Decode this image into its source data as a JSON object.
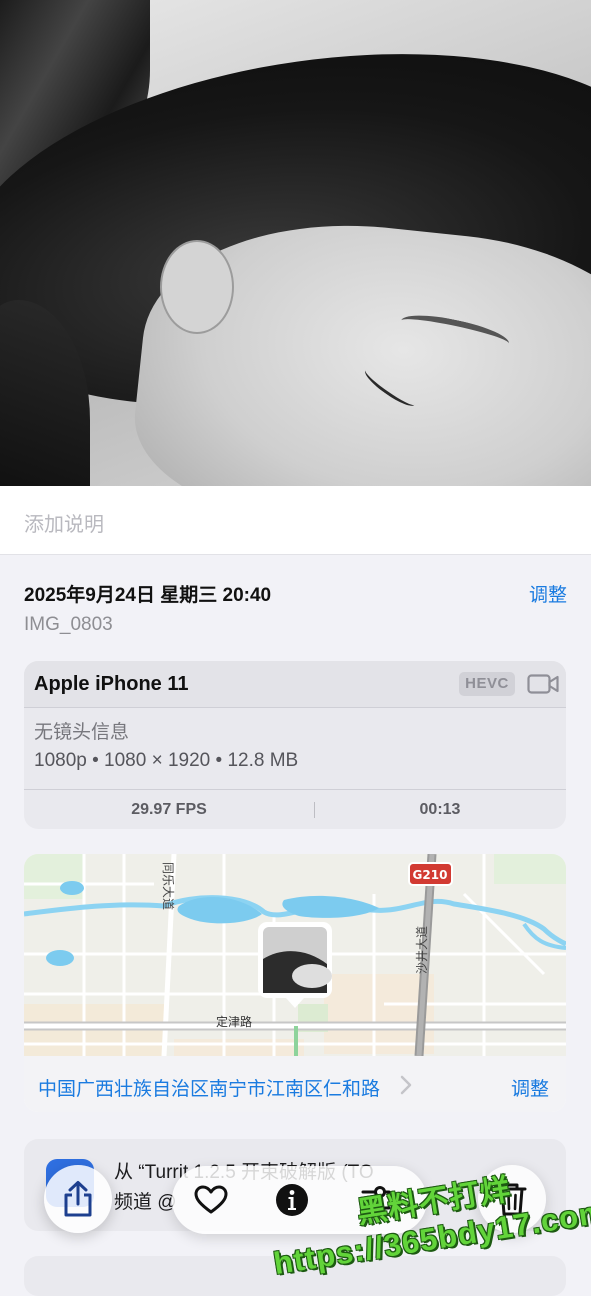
{
  "caption": {
    "placeholder": "添加说明"
  },
  "meta": {
    "datetime": "2025年9月24日 星期三 20:40",
    "adjust_label": "调整",
    "filename": "IMG_0803"
  },
  "device": {
    "name": "Apple iPhone 11",
    "codec_badge": "HEVC",
    "lens": "无镜头信息",
    "specs": "1080p • 1080 × 1920 • 12.8 MB",
    "fps": "29.97 FPS",
    "duration": "00:13",
    "icon": "video-camera-icon"
  },
  "map": {
    "labels": {
      "road_tongle": "同乐大道",
      "road_shajing": "沙井大道",
      "road_dingjin": "定津路",
      "highway": "G210"
    },
    "location_text": "中国广西壮族自治区南宁市江南区仁和路",
    "adjust_label": "调整"
  },
  "source": {
    "line1": "从 “Turrit 1.2.5 开束破解版 (TO",
    "line2": "频道 @"
  },
  "toolbar": {
    "share_icon": "share-icon",
    "favorite_icon": "heart-icon",
    "info_icon": "info-icon",
    "adjust_icon": "sliders-icon",
    "delete_icon": "trash-icon"
  },
  "watermark": {
    "line1": "黑料不打烊",
    "line2": "https://365bdy17.com"
  },
  "colors": {
    "accent": "#1a7be0",
    "background": "#f2f2f7",
    "watermark": "#62d43a"
  }
}
